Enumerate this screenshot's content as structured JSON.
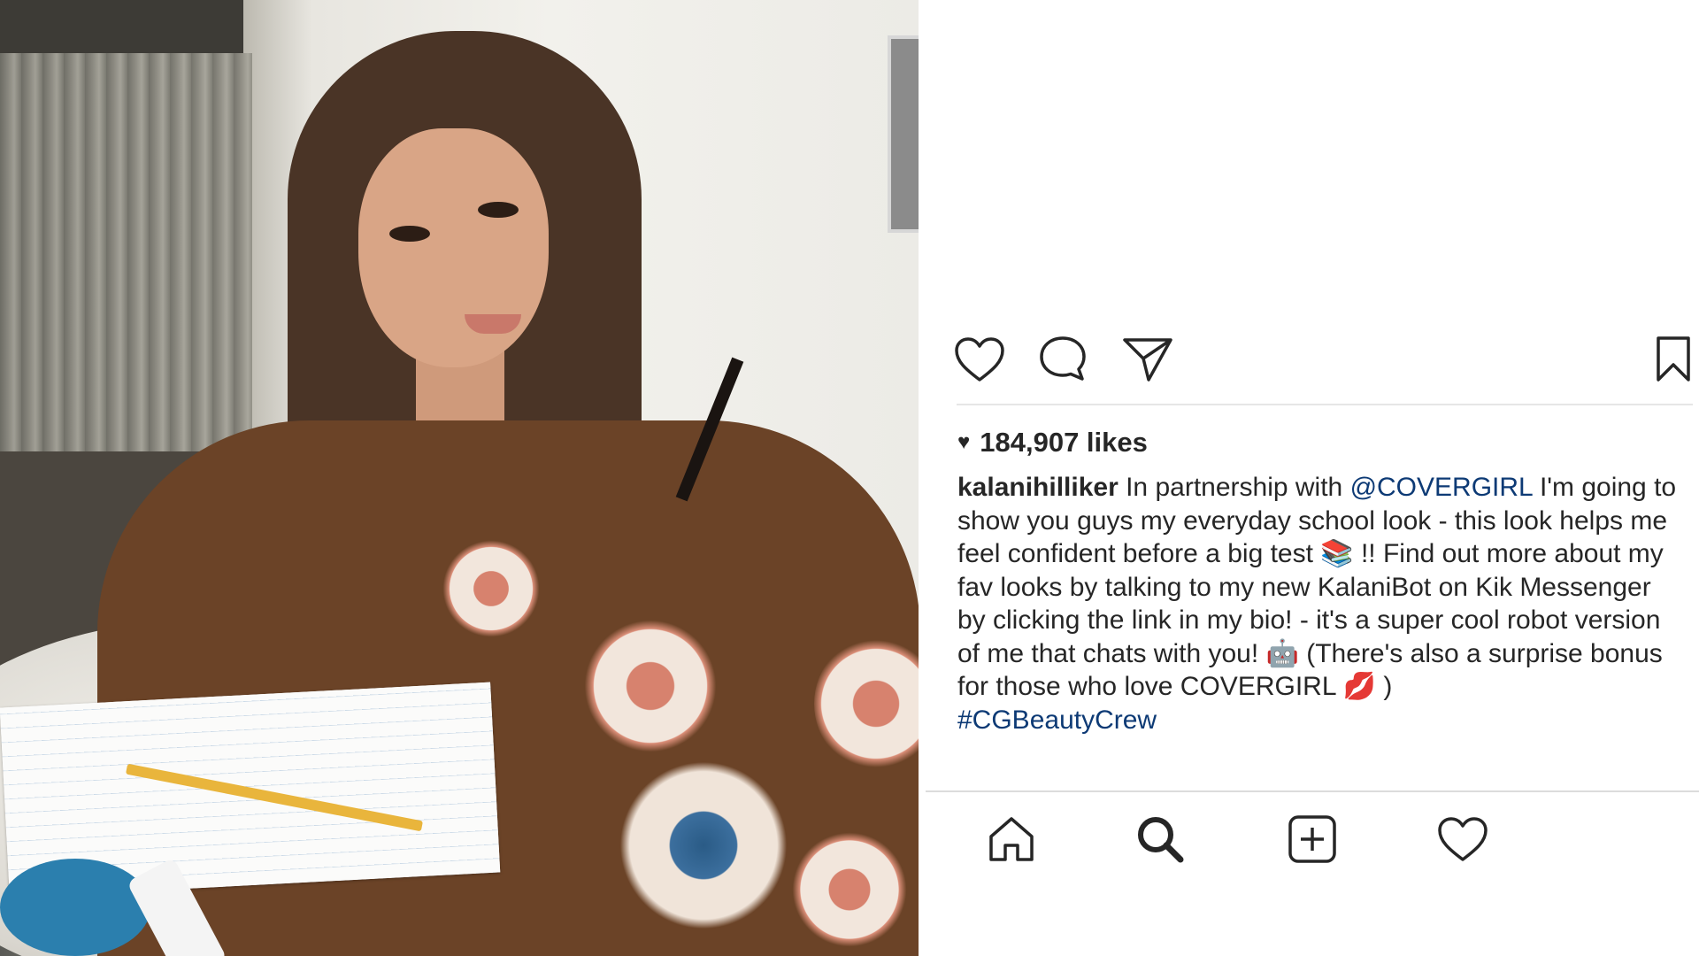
{
  "post": {
    "likes_icon": "heart-filled-icon",
    "likes_text": "184,907 likes",
    "caption": {
      "username": "kalanihilliker",
      "text_1": " In partnership with ",
      "mention": "@COVERGIRL",
      "text_2": " I'm going to show you guys my everyday school look - this look helps me feel confident before a big test ",
      "emoji_books": "📚",
      "text_3": " !! Find out more about my fav looks by talking to my new KalaniBot on Kik Messenger by clicking the link in my bio! - it's a super cool robot version of me that chats with you! ",
      "emoji_robot": "🤖",
      "text_4": " (There's also a surprise bonus for those who love COVERGIRL ",
      "emoji_lips": "💋",
      "text_5": " )",
      "hashtag": "#CGBeautyCrew"
    }
  },
  "actions": {
    "like": "heart-outline-icon",
    "comment": "comment-bubble-icon",
    "share": "paper-plane-icon",
    "save": "bookmark-icon"
  },
  "bottom_nav": {
    "home": "home-icon",
    "search": "search-icon",
    "new_post": "plus-square-icon",
    "activity": "heart-outline-icon"
  },
  "colors": {
    "text": "#262626",
    "link": "#0d3a75",
    "divider": "#e6e6e6"
  }
}
